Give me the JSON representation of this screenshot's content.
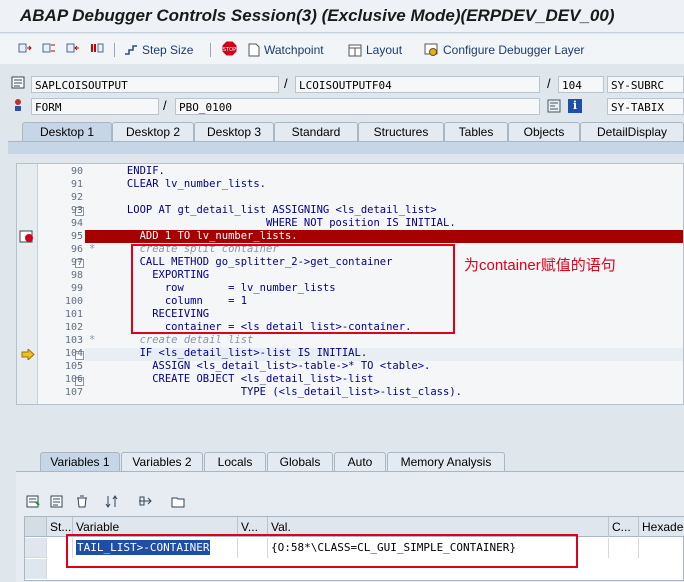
{
  "window": {
    "title": "ABAP Debugger Controls Session(3)  (Exclusive Mode)(ERPDEV_DEV_00)"
  },
  "toolbar": {
    "step_size": "Step Size",
    "watchpoint": "Watchpoint",
    "layout": "Layout",
    "configure": "Configure Debugger Layer"
  },
  "position": {
    "program": "SAPLCOISOUTPUT",
    "include": "LCOISOUTPUTF04",
    "line": "104",
    "sysvar1": "SY-SUBRC",
    "event_type": "FORM",
    "event_name": "PBO_0100",
    "sysvar2": "SY-TABIX"
  },
  "desktop_tabs": [
    "Desktop 1",
    "Desktop 2",
    "Desktop 3",
    "Standard",
    "Structures",
    "Tables",
    "Objects",
    "DetailDisplay"
  ],
  "code": {
    "lines": [
      {
        "num": "90",
        "text": "      ENDIF."
      },
      {
        "num": "91",
        "text": "      CLEAR lv_number_lists."
      },
      {
        "num": "92",
        "text": ""
      },
      {
        "num": "93",
        "text": "      LOOP AT gt_detail_list ASSIGNING <ls_detail_list>"
      },
      {
        "num": "94",
        "text": "                            WHERE NOT position IS INITIAL."
      },
      {
        "num": "95",
        "text": "        ADD 1 TO lv_number_lists."
      },
      {
        "num": "96",
        "text": "*       create split container"
      },
      {
        "num": "97",
        "text": "        CALL METHOD go_splitter_2->get_container"
      },
      {
        "num": "98",
        "text": "          EXPORTING"
      },
      {
        "num": "99",
        "text": "            row       = lv_number_lists"
      },
      {
        "num": "100",
        "text": "            column    = 1"
      },
      {
        "num": "101",
        "text": "          RECEIVING"
      },
      {
        "num": "102",
        "text": "            container = <ls_detail_list>-container."
      },
      {
        "num": "103",
        "text": "*       create detail list"
      },
      {
        "num": "104",
        "text": "        IF <ls_detail_list>-list IS INITIAL."
      },
      {
        "num": "105",
        "text": "          ASSIGN <ls_detail_list>-table->* TO <table>."
      },
      {
        "num": "106",
        "text": "          CREATE OBJECT <ls_detail_list>-list"
      },
      {
        "num": "107",
        "text": "                        TYPE (<ls_detail_list>-list_class)."
      }
    ]
  },
  "annotation_text": "为container赋值的语句",
  "var_tabs": [
    "Variables 1",
    "Variables 2",
    "Locals",
    "Globals",
    "Auto",
    "Memory Analysis"
  ],
  "grid": {
    "headers": [
      "St...",
      "Variable",
      "V...",
      "Val.",
      "C...",
      "Hexadec"
    ],
    "row": {
      "variable": "TAIL_LIST>-CONTAINER",
      "value": "{O:58*\\CLASS=CL_GUI_SIMPLE_CONTAINER}"
    }
  },
  "colors": {
    "highlight_line": "#a60000",
    "annotation": "#e0001a",
    "selected_variable": "#1f4ea6"
  }
}
